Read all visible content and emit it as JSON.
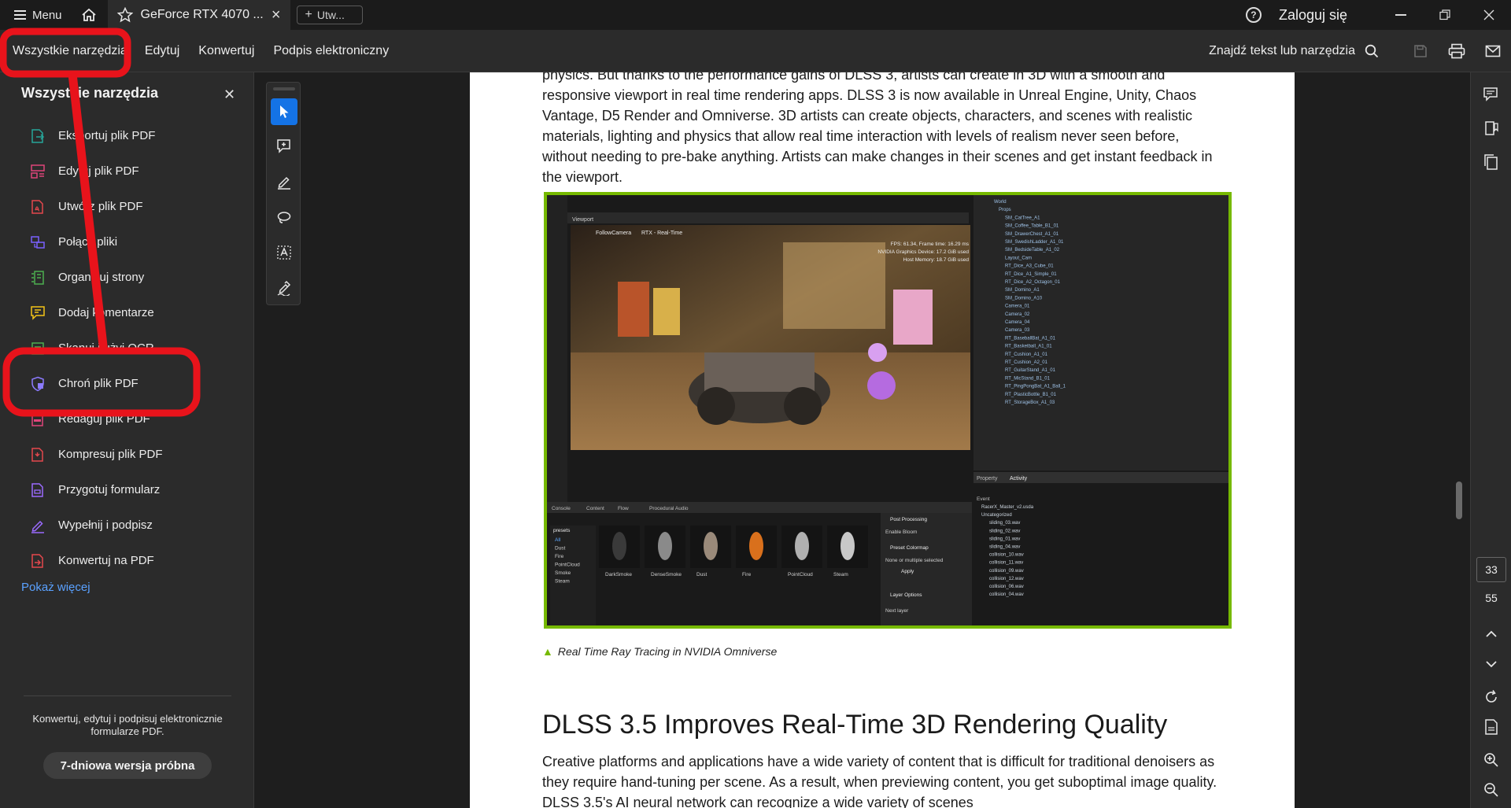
{
  "titlebar": {
    "menu_label": "Menu",
    "tab_title": "GeForce RTX 4070 ...",
    "new_tab_label": "Utw...",
    "signin_label": "Zaloguj się"
  },
  "toolbar": {
    "items": [
      "Wszystkie narzędzia",
      "Edytuj",
      "Konwertuj",
      "Podpis elektroniczny"
    ],
    "find_label": "Znajdź tekst lub narzędzia"
  },
  "tools_panel": {
    "title": "Wszystkie narzędzia",
    "items": [
      {
        "label": "Eksportuj plik PDF",
        "icon": "export-pdf-icon",
        "color": "#26a69a"
      },
      {
        "label": "Edytuj plik PDF",
        "icon": "edit-pdf-icon",
        "color": "#e0457b"
      },
      {
        "label": "Utwórz plik PDF",
        "icon": "create-pdf-icon",
        "color": "#e5484d"
      },
      {
        "label": "Połącz pliki",
        "icon": "combine-files-icon",
        "color": "#7b61ff"
      },
      {
        "label": "Organizuj strony",
        "icon": "organize-pages-icon",
        "color": "#4caf50"
      },
      {
        "label": "Dodaj komentarze",
        "icon": "add-comment-icon",
        "color": "#f5c518"
      },
      {
        "label": "Skanuj i użyj OCR",
        "icon": "scan-ocr-icon",
        "color": "#4caf50"
      },
      {
        "label": "Chroń plik PDF",
        "icon": "protect-pdf-icon",
        "color": "#8c7bff"
      },
      {
        "label": "Redaguj plik PDF",
        "icon": "redact-pdf-icon",
        "color": "#e0457b"
      },
      {
        "label": "Kompresuj plik PDF",
        "icon": "compress-pdf-icon",
        "color": "#e5484d"
      },
      {
        "label": "Przygotuj formularz",
        "icon": "prepare-form-icon",
        "color": "#9b6bff"
      },
      {
        "label": "Wypełnij i podpisz",
        "icon": "fill-sign-icon",
        "color": "#9b6bff"
      },
      {
        "label": "Konwertuj na PDF",
        "icon": "convert-pdf-icon",
        "color": "#e5484d"
      }
    ],
    "more_link": "Pokaż więcej",
    "promo_text": "Konwertuj, edytuj i podpisuj elektronicznie formularze PDF.",
    "trial_button": "7-dniowa wersja próbna"
  },
  "document": {
    "paragraph1": "physics. But thanks to the performance gains of DLSS 3, artists can create in 3D with a smooth and responsive viewport in real time rendering apps. DLSS 3 is now available in Unreal Engine, Unity, Chaos Vantage, D5 Render and Omniverse. 3D artists can create objects, characters, and scenes with realistic materials, lighting and physics that allow real time interaction with levels of realism never seen before, without needing to pre-bake anything. Artists can make changes in their scenes and get instant feedback in the viewport.",
    "caption": "Real Time Ray Tracing in NVIDIA Omniverse",
    "heading": "DLSS 3.5 Improves Real-Time 3D Rendering Quality",
    "paragraph2": "Creative platforms and applications have a wide variety of content that is difficult for traditional denoisers as they require hand-tuning per scene. As a result, when previewing content, you get suboptimal image quality. DLSS 3.5's AI neural network can recognize a wide variety of scenes"
  },
  "figure": {
    "viewport_tab": "Viewport",
    "camera_label": "FollowCamera",
    "render_label": "RTX - Real-Time",
    "stats_fps": "FPS: 61.34, Frame time: 16.29 ms",
    "stats_device": "NVIDIA Graphics Device: 17.2 GiB used",
    "stats_memory": "Host Memory: 18.7 GiB used",
    "tree_items": [
      "World",
      "Props",
      "SM_CatTree_A1",
      "SM_Coffee_Table_B1_01",
      "SM_DrawerChest_A1_01",
      "SM_SwedishLadder_A1_01",
      "SM_BedsideTable_A1_02",
      "Layout_Cam",
      "RT_Dice_A3_Cube_01",
      "RT_Dice_A1_Simple_01",
      "RT_Dice_A2_Octagon_01",
      "SM_Domino_A1",
      "SM_Domino_A10",
      "Camera_01",
      "Camera_02",
      "Camera_04",
      "Camera_03",
      "RT_BaseballBat_A1_01",
      "RT_Basketball_A1_01",
      "RT_Cushion_A1_01",
      "RT_Cushion_A2_01",
      "RT_GuitarStand_A1_01",
      "RT_MicStand_B1_01",
      "RT_PingPongBat_A1_Ball_1",
      "RT_PlasticBottle_B1_01",
      "RT_StorageBox_A1_03"
    ],
    "prop_tabs": [
      "Property",
      "Activity"
    ],
    "bottom_tabs": [
      "Console",
      "Content",
      "Flow",
      "Procedural Audio"
    ],
    "presets_label": "presets",
    "preset_items": [
      "All",
      "Dust",
      "Fire",
      "PointCloud",
      "Smoke",
      "Steam"
    ],
    "asset_labels": [
      "DarkSmoke",
      "DenseSmoke",
      "Dust",
      "Fire",
      "PointCloud",
      "Steam"
    ],
    "post_processing": "Post Processing",
    "enable_bloom": "Enable Bloom",
    "preset_colormap": "Preset Colormap",
    "colormap_value": "None or multiple selected",
    "apply_label": "Apply",
    "layer_options": "Layer Options",
    "next_layer": "Next layer",
    "event_label": "Event",
    "event_items": [
      "RacerX_Master_v2.usda",
      "Uncategorized",
      "sliding_03.wav",
      "sliding_02.wav",
      "sliding_01.wav",
      "sliding_04.wav",
      "collision_10.wav",
      "collision_11.wav",
      "collision_09.wav",
      "collision_12.wav",
      "collision_06.wav",
      "collision_04.wav"
    ]
  },
  "right_rail": {
    "current_page": "33",
    "total_pages": "55"
  },
  "colors": {
    "accent_blue": "#1473e6",
    "annotation_red": "#e8131b",
    "nvidia_green": "#76b900"
  }
}
